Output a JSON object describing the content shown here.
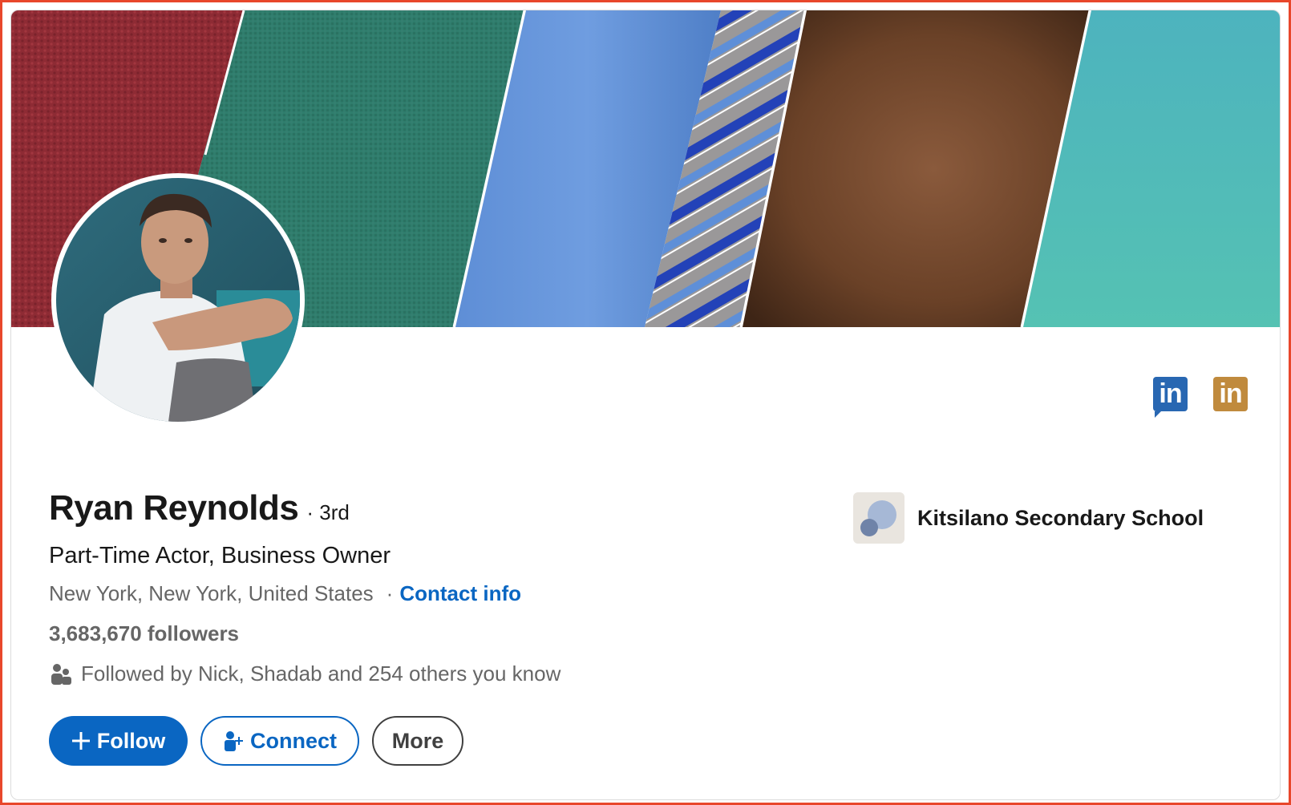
{
  "profile": {
    "name": "Ryan Reynolds",
    "degree": "· 3rd",
    "headline": "Part-Time Actor, Business Owner",
    "location": "New York, New York, United States",
    "location_separator": "·",
    "contact_info_label": "Contact info",
    "followers": "3,683,670 followers",
    "followed_by": "Followed by Nick, Shadab and 254 others you know"
  },
  "actions": {
    "follow_label": "Follow",
    "connect_label": "Connect",
    "more_label": "More"
  },
  "education": {
    "school_name": "Kitsilano Secondary School"
  },
  "top_icons": {
    "first": "in",
    "second": "in"
  },
  "colors": {
    "accent": "#0a66c2",
    "frame_border": "#e8472b",
    "linkedin_blue": "#2867b2",
    "linkedin_gold": "#c08a3d"
  },
  "icons": [
    "linkedin-blue-icon",
    "linkedin-gold-icon",
    "people-icon",
    "plus-icon",
    "add-person-icon",
    "school-logo-icon"
  ]
}
